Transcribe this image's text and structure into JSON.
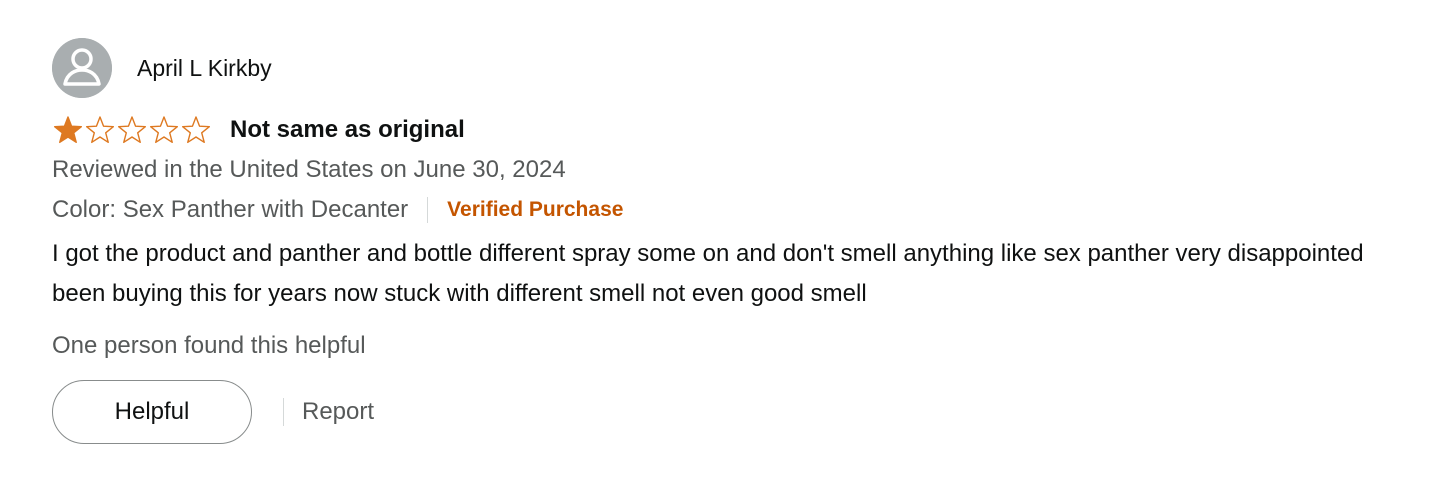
{
  "review": {
    "profile_name": "April L Kirkby",
    "avatar_icon": "default-user-avatar-icon",
    "rating": 1,
    "rating_max": 5,
    "star_color": "#de7921",
    "title": "Not same as original",
    "date_line": "Reviewed in the United States on June 30, 2024",
    "format": "Color: Sex Panther with Decanter",
    "verified_label": "Verified Purchase",
    "verified_color": "#c45500",
    "body": "I got the product and panther and bottle different spray some on and don't smell anything like sex panther very disappointed been buying this for years now stuck with different smell not even good smell",
    "helpful_count_text": "One person found this helpful",
    "helpful_button_label": "Helpful",
    "report_label": "Report"
  }
}
